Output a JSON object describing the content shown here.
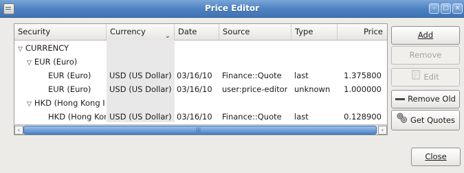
{
  "window": {
    "title": "Price Editor"
  },
  "table": {
    "columns": [
      "Security",
      "Currency",
      "Date",
      "Source",
      "Type",
      "Price"
    ],
    "rows": [
      {
        "security": "CURRENCY",
        "currency": "",
        "date": "",
        "source": "",
        "type": "",
        "price": ""
      },
      {
        "security": "EUR (Euro)",
        "currency": "",
        "date": "",
        "source": "",
        "type": "",
        "price": ""
      },
      {
        "security": "EUR (Euro)",
        "currency": "USD (US Dollar)",
        "date": "03/16/10",
        "source": "Finance::Quote",
        "type": "last",
        "price": "1.375800"
      },
      {
        "security": "EUR (Euro)",
        "currency": "USD (US Dollar)",
        "date": "03/16/10",
        "source": "user:price-editor",
        "type": "unknown",
        "price": "1.000000"
      },
      {
        "security": "HKD (Hong Kong I",
        "currency": "",
        "date": "",
        "source": "",
        "type": "",
        "price": ""
      },
      {
        "security": "HKD (Hong Kor",
        "currency": "USD (US Dollar)",
        "date": "03/16/10",
        "source": "Finance::Quote",
        "type": "last",
        "price": "0.128900"
      }
    ]
  },
  "buttons": {
    "add": "Add",
    "remove": "Remove",
    "edit": "Edit",
    "remove_old": "Remove Old",
    "get_quotes": "Get Quotes",
    "close": "Close"
  }
}
